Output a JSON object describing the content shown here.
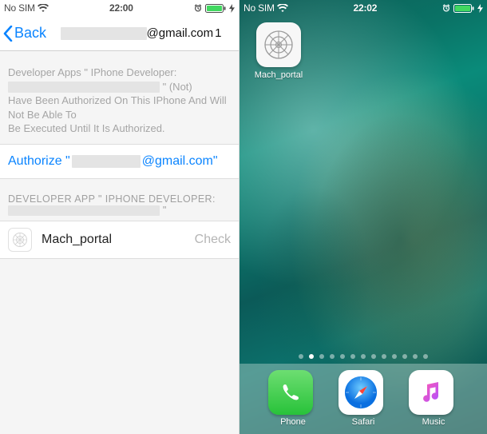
{
  "left": {
    "status": {
      "carrier": "No SIM",
      "time": "22:00"
    },
    "nav": {
      "back": "Back",
      "title_suffix": "@gmail.com",
      "title_count": "1"
    },
    "info": {
      "line1_prefix": "Developer Apps \" IPhone Developer:",
      "line2_suffix": "\" (Not)",
      "line3": "Have Been Authorized On This IPhone And Will Not Be Able To",
      "line4": "Be Executed Until It Is Authorized."
    },
    "authorize": {
      "prefix": "Authorize \"",
      "suffix": "@gmail.com\""
    },
    "section": {
      "prefix": "DEVELOPER APP \" IPHONE DEVELOPER:",
      "suffix": "\""
    },
    "app": {
      "name": "Mach_portal",
      "status": "Check"
    }
  },
  "right": {
    "status": {
      "carrier": "No SIM",
      "time": "22:02"
    },
    "home_app": {
      "label": "Mach_portal"
    },
    "page_count": 13,
    "active_page": 1,
    "dock": [
      {
        "id": "phone",
        "label": "Phone"
      },
      {
        "id": "safari",
        "label": "Safari"
      },
      {
        "id": "music",
        "label": "Music"
      }
    ]
  }
}
